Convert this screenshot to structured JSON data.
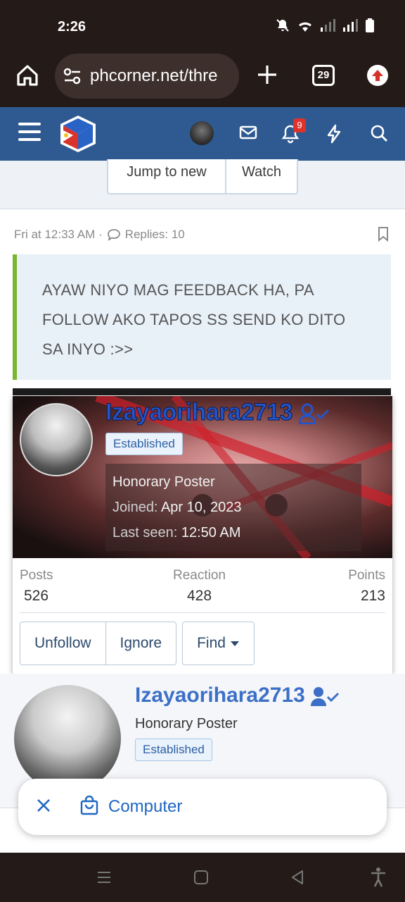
{
  "status_bar": {
    "time": "2:26"
  },
  "browser": {
    "url": "phcorner.net/thre",
    "tab_count": "29"
  },
  "site_header": {
    "notification_count": "9"
  },
  "thread_nav": {
    "jump_label": "Jump to new",
    "watch_label": "Watch"
  },
  "post": {
    "meta_time": "Fri at 12:33 AM ·",
    "meta_replies": "Replies: 10",
    "quote_text": "AYAW NIYO MAG FEEDBACK HA, PA FOLLOW AKO TAPOS SS SEND KO DITO SA INYO :>>"
  },
  "tooltip": {
    "username": "Izayaorihara2713",
    "badge": "Established",
    "title": "Honorary Poster",
    "joined_label": "Joined:",
    "joined_value": "Apr 10, 2023",
    "last_seen_label": "Last seen:",
    "last_seen_value": "12:50 AM",
    "stats": {
      "posts_label": "Posts",
      "posts_value": "526",
      "reaction_label": "Reaction",
      "reaction_value": "428",
      "points_label": "Points",
      "points_value": "213"
    },
    "unfollow_label": "Unfollow",
    "ignore_label": "Ignore",
    "find_label": "Find"
  },
  "member": {
    "username": "Izayaorihara2713",
    "title": "Honorary Poster",
    "badge": "Established"
  },
  "chip": {
    "label": "Computer"
  },
  "colors": {
    "header_blue": "#2e5a91",
    "quote_accent": "#7ab62f",
    "link_blue": "#3c70c8",
    "chip_blue": "#1f66c1"
  }
}
